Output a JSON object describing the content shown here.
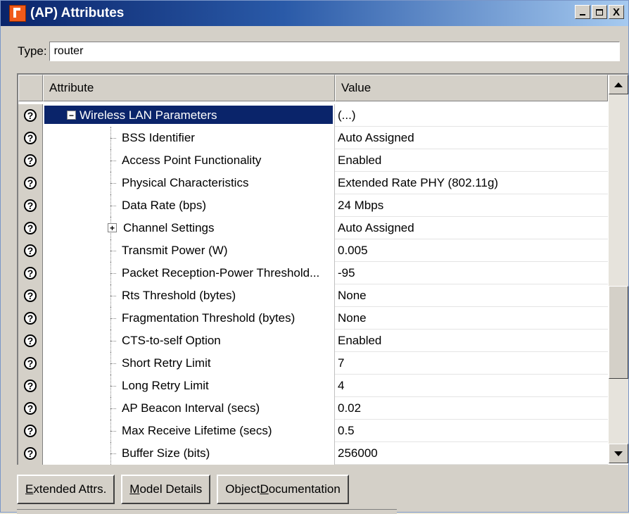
{
  "window": {
    "title": "(AP) Attributes",
    "minimize": "_",
    "maximize": "□",
    "close": "X"
  },
  "type_field": {
    "label": "Type:",
    "value": "router"
  },
  "grid": {
    "headers": [
      "",
      "Attribute",
      "Value"
    ],
    "help_glyph": "?",
    "rows": [
      {
        "label": "Wireless LAN Parameters",
        "value": "(...)",
        "level": 0,
        "expander": "−",
        "selected": true
      },
      {
        "label": "BSS Identifier",
        "value": "Auto Assigned",
        "level": 1
      },
      {
        "label": "Access Point Functionality",
        "value": "Enabled",
        "level": 1
      },
      {
        "label": "Physical Characteristics",
        "value": "Extended Rate PHY (802.11g)",
        "level": 1
      },
      {
        "label": "Data Rate (bps)",
        "value": "24 Mbps",
        "level": 1
      },
      {
        "label": "Channel Settings",
        "value": "Auto Assigned",
        "level": 1,
        "expander": "+"
      },
      {
        "label": "Transmit Power (W)",
        "value": "0.005",
        "level": 1
      },
      {
        "label": "Packet Reception-Power Threshold...",
        "value": "-95",
        "level": 1
      },
      {
        "label": "Rts Threshold (bytes)",
        "value": "None",
        "level": 1
      },
      {
        "label": "Fragmentation Threshold (bytes)",
        "value": "None",
        "level": 1
      },
      {
        "label": "CTS-to-self Option",
        "value": "Enabled",
        "level": 1
      },
      {
        "label": "Short Retry Limit",
        "value": "7",
        "level": 1
      },
      {
        "label": "Long Retry Limit",
        "value": "4",
        "level": 1
      },
      {
        "label": "AP Beacon Interval (secs)",
        "value": "0.02",
        "level": 1
      },
      {
        "label": "Max Receive Lifetime (secs)",
        "value": "0.5",
        "level": 1
      },
      {
        "label": "Buffer Size (bits)",
        "value": "256000",
        "level": 1
      }
    ]
  },
  "buttons": {
    "extended": {
      "key": "E",
      "rest": "xtended Attrs."
    },
    "model": {
      "key": "M",
      "rest": "odel Details"
    },
    "doc": {
      "pre": "Object ",
      "key": "D",
      "rest": "ocumentation"
    }
  },
  "colors": {
    "selection": "#0a246a",
    "face": "#d4d0c8",
    "title_gradient_start": "#0a246a",
    "title_gradient_end": "#a6caf0",
    "app_icon": "#f05a1a"
  }
}
